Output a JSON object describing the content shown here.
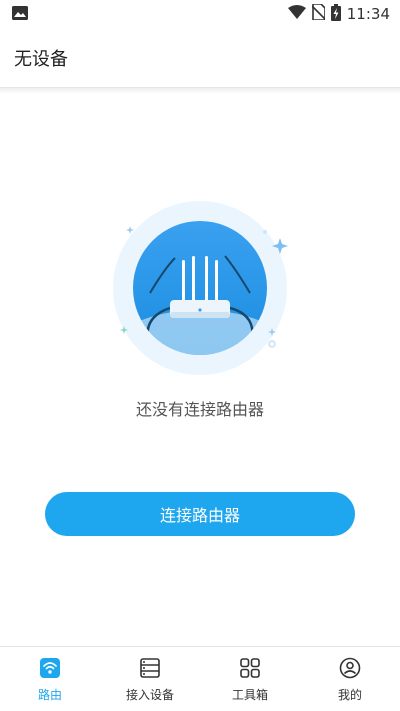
{
  "status_bar": {
    "time": "11:34"
  },
  "app_bar": {
    "title": "无设备"
  },
  "empty_state": {
    "message": "还没有连接路由器"
  },
  "connect_button": {
    "label": "连接路由器"
  },
  "tabs": [
    {
      "label": "路由",
      "icon": "router-icon",
      "active": true
    },
    {
      "label": "接入设备",
      "icon": "devices-icon",
      "active": false
    },
    {
      "label": "工具箱",
      "icon": "toolbox-icon",
      "active": false
    },
    {
      "label": "我的",
      "icon": "profile-icon",
      "active": false
    }
  ],
  "colors": {
    "accent": "#1EA7EE",
    "text": "#222222",
    "muted": "#555555"
  }
}
